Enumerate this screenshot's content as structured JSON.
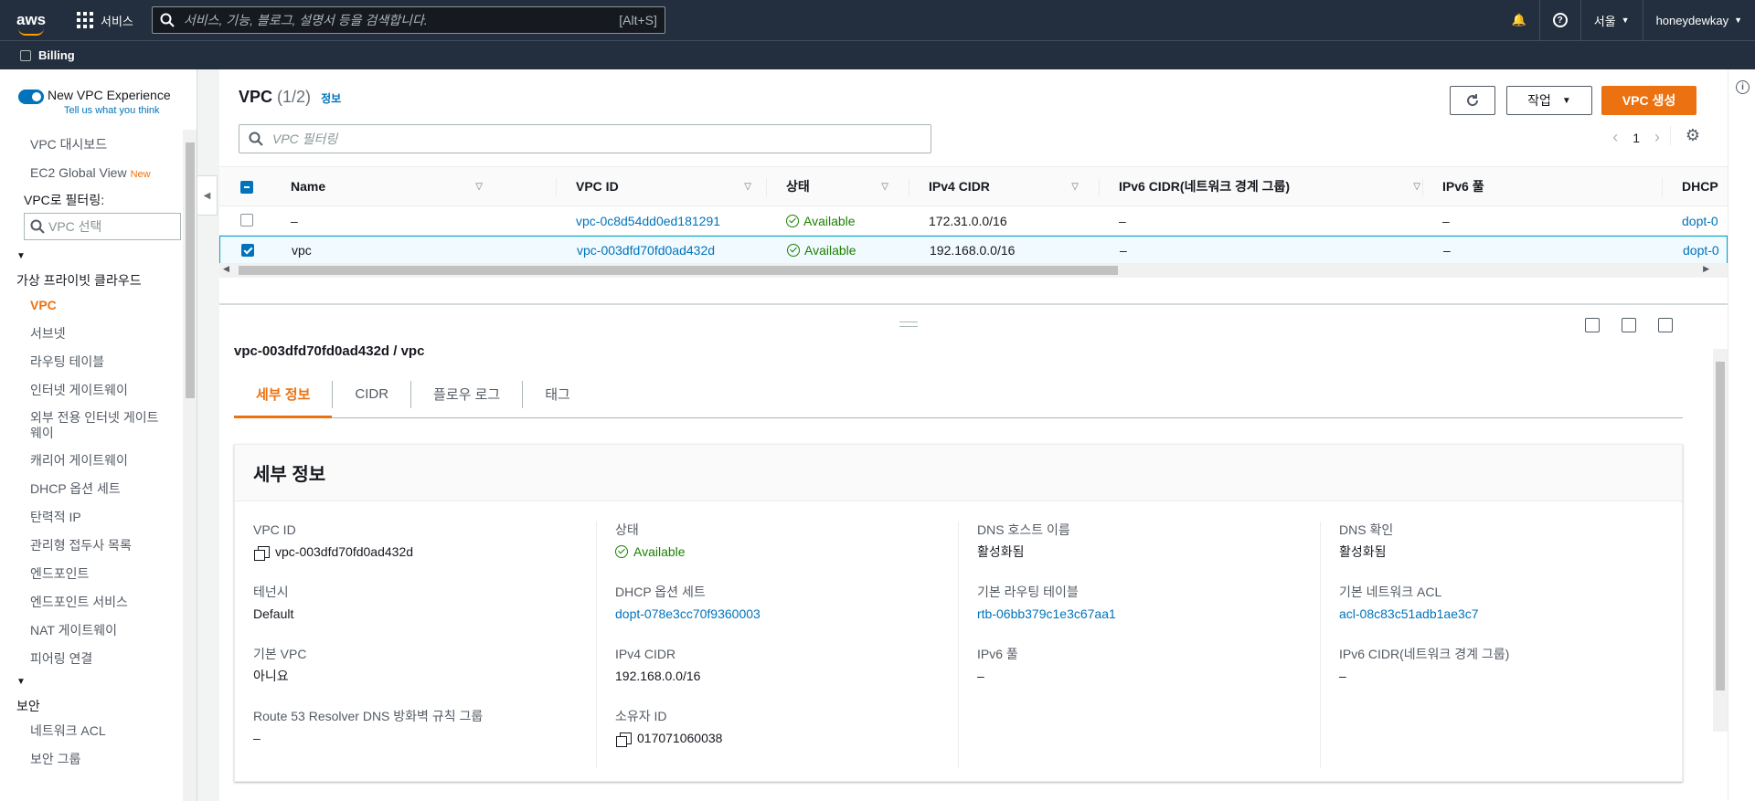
{
  "topnav": {
    "logo": "aws",
    "services_label": "서비스",
    "search_placeholder": "서비스, 기능, 블로그, 설명서 등을 검색합니다.",
    "search_shortcut": "[Alt+S]",
    "region": "서울",
    "user": "honeydewkay"
  },
  "subnav": {
    "billing_label": "Billing"
  },
  "sidebar": {
    "toggle_label": "New VPC Experience",
    "tell_us": "Tell us what you think",
    "top_items": [
      {
        "label": "VPC 대시보드"
      },
      {
        "label": "EC2 Global View",
        "badge": "New"
      }
    ],
    "filter_label": "VPC로 필터링:",
    "vpc_select_placeholder": "VPC 선택",
    "section_vpc": "가상 프라이빗 클라우드",
    "vpc_items": [
      "VPC",
      "서브넷",
      "라우팅 테이블",
      "인터넷 게이트웨이",
      "외부 전용 인터넷 게이트웨이",
      "캐리어 게이트웨이",
      "DHCP 옵션 세트",
      "탄력적 IP",
      "관리형 접두사 목록",
      "엔드포인트",
      "엔드포인트 서비스",
      "NAT 게이트웨이",
      "피어링 연결"
    ],
    "section_security": "보안",
    "security_items": [
      "네트워크 ACL",
      "보안 그룹"
    ]
  },
  "main": {
    "title": "VPC",
    "count": "(1/2)",
    "info_link": "정보",
    "actions_label": "작업",
    "create_label": "VPC 생성",
    "filter_placeholder": "VPC 필터링",
    "page": "1",
    "columns": [
      "Name",
      "VPC ID",
      "상태",
      "IPv4 CIDR",
      "IPv6 CIDR(네트워크 경계 그룹)",
      "IPv6 풀",
      "DHCP"
    ],
    "rows": [
      {
        "name": "–",
        "vpc_id": "vpc-0c8d54dd0ed181291",
        "status": "Available",
        "ipv4": "172.31.0.0/16",
        "ipv6": "–",
        "ipv6_pool": "–",
        "dhcp": "dopt-0",
        "selected": false
      },
      {
        "name": "vpc",
        "vpc_id": "vpc-003dfd70fd0ad432d",
        "status": "Available",
        "ipv4": "192.168.0.0/16",
        "ipv6": "–",
        "ipv6_pool": "–",
        "dhcp": "dopt-0",
        "selected": true
      }
    ]
  },
  "details": {
    "title": "vpc-003dfd70fd0ad432d / vpc",
    "tabs": [
      "세부 정보",
      "CIDR",
      "플로우 로그",
      "태그"
    ],
    "card_title": "세부 정보",
    "col1": [
      {
        "k": "VPC ID",
        "v": "vpc-003dfd70fd0ad432d"
      },
      {
        "k": "테넌시",
        "v": "Default"
      },
      {
        "k": "기본 VPC",
        "v": "아니요"
      },
      {
        "k": "Route 53 Resolver DNS 방화벽 규칙 그룹",
        "v": "–"
      }
    ],
    "col2": [
      {
        "k": "상태",
        "v": "Available"
      },
      {
        "k": "DHCP 옵션 세트",
        "v": "dopt-078e3cc70f9360003"
      },
      {
        "k": "IPv4 CIDR",
        "v": "192.168.0.0/16"
      },
      {
        "k": "소유자 ID",
        "v": "017071060038"
      }
    ],
    "col3": [
      {
        "k": "DNS 호스트 이름",
        "v": "활성화됨"
      },
      {
        "k": "기본 라우팅 테이블",
        "v": "rtb-06bb379c1e3c67aa1"
      },
      {
        "k": "IPv6 풀",
        "v": "–"
      }
    ],
    "col4": [
      {
        "k": "DNS 확인",
        "v": "활성화됨"
      },
      {
        "k": "기본 네트워크 ACL",
        "v": "acl-08c83c51adb1ae3c7"
      },
      {
        "k": "IPv6 CIDR(네트워크 경계 그룹)",
        "v": "–"
      }
    ]
  },
  "colors": {
    "nav": "#232f3e",
    "accent": "#ec7211",
    "link": "#0073bb",
    "success": "#1d8102"
  }
}
